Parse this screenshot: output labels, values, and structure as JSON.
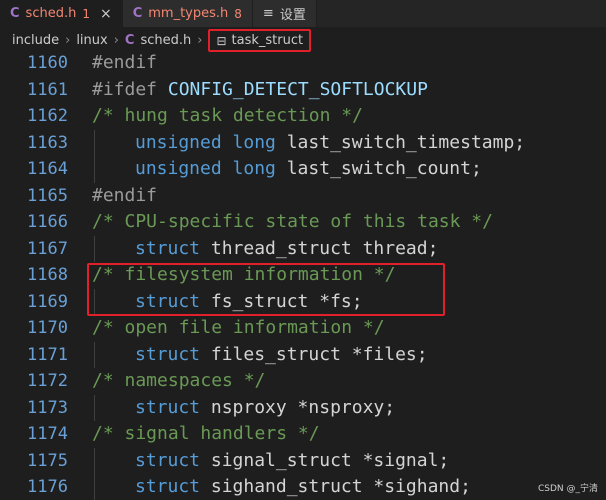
{
  "tabs": [
    {
      "lang": "C",
      "name": "sched.h",
      "count": "1",
      "close": "×",
      "active": true
    },
    {
      "lang": "C",
      "name": "mm_types.h",
      "count": "8",
      "active": false
    },
    {
      "icon": "≡",
      "name": "设置",
      "active": false
    }
  ],
  "breadcrumbs": {
    "items": [
      "include",
      "linux",
      "sched.h",
      "task_struct"
    ],
    "sep": "›",
    "file_lang": "C",
    "struct_icon": "⊟"
  },
  "lines": [
    {
      "n": "1160",
      "indent": false,
      "tokens": [
        {
          "c": "p",
          "t": "#endif"
        }
      ]
    },
    {
      "n": "1161",
      "indent": false,
      "tokens": [
        {
          "c": "p",
          "t": "#ifdef "
        },
        {
          "c": "pp",
          "t": "CONFIG_DETECT_SOFTLOCKUP"
        }
      ]
    },
    {
      "n": "1162",
      "indent": false,
      "tokens": [
        {
          "c": "c",
          "t": "/* hung task detection */"
        }
      ]
    },
    {
      "n": "1163",
      "indent": true,
      "tokens": [
        {
          "c": "k",
          "t": "unsigned long "
        },
        {
          "c": "v",
          "t": "last_switch_timestamp;"
        }
      ]
    },
    {
      "n": "1164",
      "indent": true,
      "tokens": [
        {
          "c": "k",
          "t": "unsigned long "
        },
        {
          "c": "v",
          "t": "last_switch_count;"
        }
      ]
    },
    {
      "n": "1165",
      "indent": false,
      "tokens": [
        {
          "c": "p",
          "t": "#endif"
        }
      ]
    },
    {
      "n": "1166",
      "indent": false,
      "tokens": [
        {
          "c": "c",
          "t": "/* CPU-specific state of this task */"
        }
      ]
    },
    {
      "n": "1167",
      "indent": true,
      "tokens": [
        {
          "c": "k",
          "t": "struct "
        },
        {
          "c": "v",
          "t": "thread_struct thread;"
        }
      ]
    },
    {
      "n": "1168",
      "indent": false,
      "tokens": [
        {
          "c": "c",
          "t": "/* filesystem information */"
        }
      ]
    },
    {
      "n": "1169",
      "indent": true,
      "tokens": [
        {
          "c": "k",
          "t": "struct "
        },
        {
          "c": "v",
          "t": "fs_struct *fs;"
        }
      ]
    },
    {
      "n": "1170",
      "indent": false,
      "tokens": [
        {
          "c": "c",
          "t": "/* open file information */"
        }
      ]
    },
    {
      "n": "1171",
      "indent": true,
      "tokens": [
        {
          "c": "k",
          "t": "struct "
        },
        {
          "c": "v",
          "t": "files_struct *files;"
        }
      ]
    },
    {
      "n": "1172",
      "indent": false,
      "tokens": [
        {
          "c": "c",
          "t": "/* namespaces */"
        }
      ]
    },
    {
      "n": "1173",
      "indent": true,
      "tokens": [
        {
          "c": "k",
          "t": "struct "
        },
        {
          "c": "v",
          "t": "nsproxy *nsproxy;"
        }
      ]
    },
    {
      "n": "1174",
      "indent": false,
      "tokens": [
        {
          "c": "c",
          "t": "/* signal handlers */"
        }
      ]
    },
    {
      "n": "1175",
      "indent": true,
      "tokens": [
        {
          "c": "k",
          "t": "struct "
        },
        {
          "c": "v",
          "t": "signal_struct *signal;"
        }
      ]
    },
    {
      "n": "1176",
      "indent": true,
      "tokens": [
        {
          "c": "k",
          "t": "struct "
        },
        {
          "c": "v",
          "t": "sighand_struct *sighand;"
        }
      ]
    }
  ],
  "watermark": "CSDN @_宁清",
  "colors": {
    "background": "#1e1e1e",
    "keyword": "#569cd6",
    "comment": "#6a9955",
    "preprocessor": "#9b9b9b",
    "line_number": "#6aa0d6",
    "highlight_border": "#e0202a",
    "c_file_icon": "#a074c4",
    "error_text": "#f48771"
  }
}
